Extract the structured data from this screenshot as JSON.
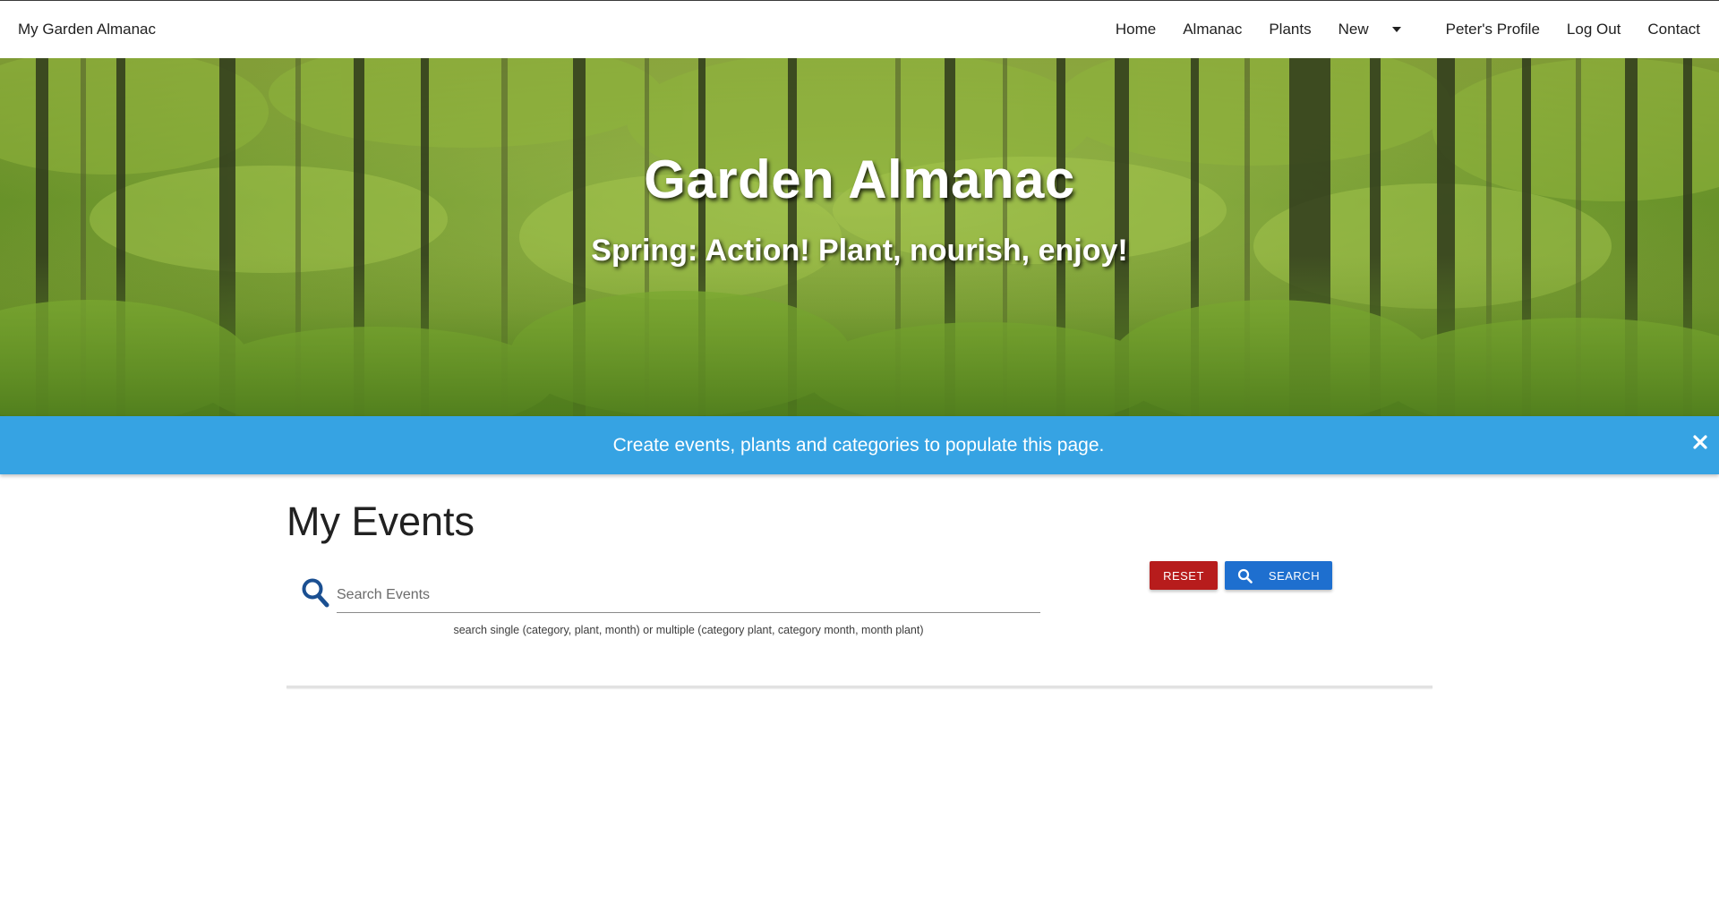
{
  "navbar": {
    "brand": "My Garden Almanac",
    "links": [
      "Home",
      "Almanac",
      "Plants",
      "New",
      "Peter's Profile",
      "Log Out",
      "Contact"
    ]
  },
  "hero": {
    "title": "Garden Almanac",
    "subtitle": "Spring: Action! Plant, nourish, enjoy!"
  },
  "alert": {
    "message": "Create events, plants and categories to populate this page.",
    "color": "#36a3e3"
  },
  "main": {
    "title": "My Events",
    "search": {
      "placeholder": "Search Events",
      "value": "",
      "help": "search single (category, plant, month) or multiple (category plant, category month, month plant)",
      "icon": "search-icon"
    },
    "buttons": {
      "reset_label": "RESET",
      "search_label": "SEARCH",
      "reset_color": "#b71c1c",
      "search_color": "#1e6fcf"
    }
  }
}
